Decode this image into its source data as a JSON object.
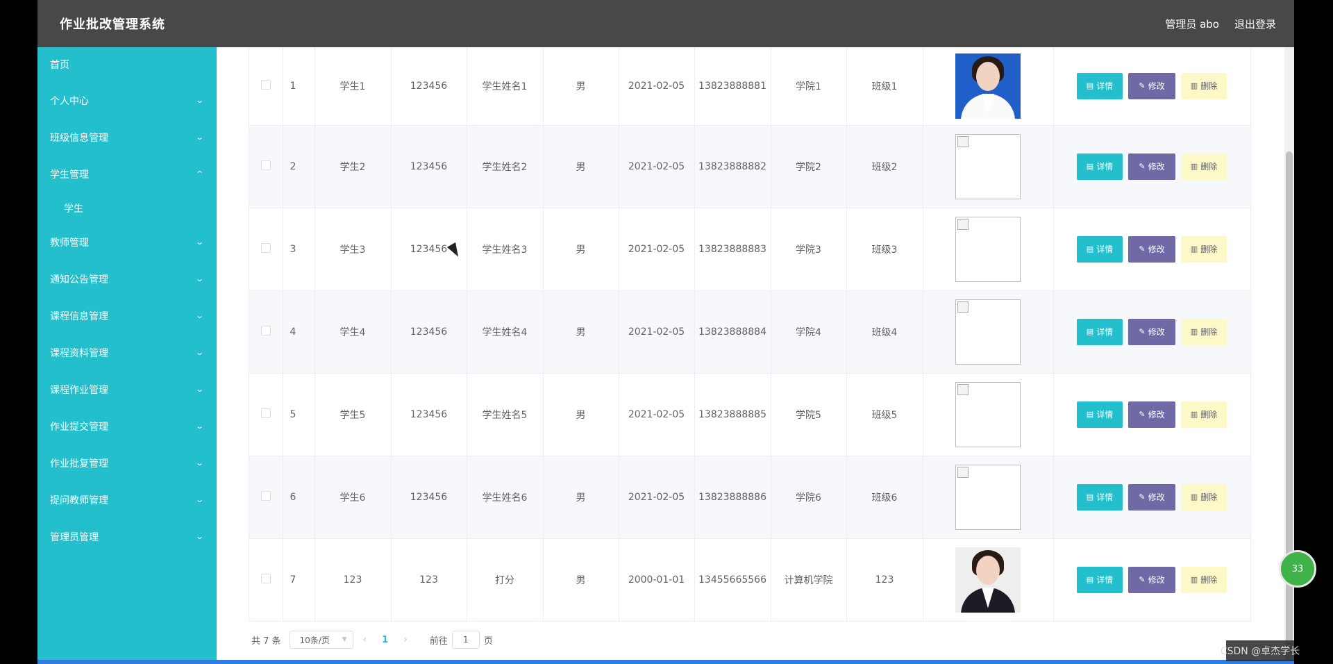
{
  "header": {
    "title": "作业批改管理系统",
    "user": "管理员 abo",
    "logout": "退出登录"
  },
  "sidebar": {
    "items": [
      {
        "label": "首页",
        "arrow": ""
      },
      {
        "label": "个人中心",
        "arrow": "⌄"
      },
      {
        "label": "班级信息管理",
        "arrow": "⌄"
      },
      {
        "label": "学生管理",
        "arrow": "⌃"
      },
      {
        "label": "学生",
        "arrow": ""
      },
      {
        "label": "教师管理",
        "arrow": "⌄"
      },
      {
        "label": "通知公告管理",
        "arrow": "⌄"
      },
      {
        "label": "课程信息管理",
        "arrow": "⌄"
      },
      {
        "label": "课程资料管理",
        "arrow": "⌄"
      },
      {
        "label": "课程作业管理",
        "arrow": "⌄"
      },
      {
        "label": "作业提交管理",
        "arrow": "⌄"
      },
      {
        "label": "作业批复管理",
        "arrow": "⌄"
      },
      {
        "label": "提问教师管理",
        "arrow": "⌄"
      },
      {
        "label": "管理员管理",
        "arrow": "⌄"
      }
    ]
  },
  "table": {
    "rows": [
      {
        "idx": "1",
        "account": "学生1",
        "password": "123456",
        "name": "学生姓名1",
        "gender": "男",
        "date": "2021-02-05",
        "phone": "13823888881",
        "college": "学院1",
        "clazz": "班级1"
      },
      {
        "idx": "2",
        "account": "学生2",
        "password": "123456",
        "name": "学生姓名2",
        "gender": "男",
        "date": "2021-02-05",
        "phone": "13823888882",
        "college": "学院2",
        "clazz": "班级2"
      },
      {
        "idx": "3",
        "account": "学生3",
        "password": "123456",
        "name": "学生姓名3",
        "gender": "男",
        "date": "2021-02-05",
        "phone": "13823888883",
        "college": "学院3",
        "clazz": "班级3"
      },
      {
        "idx": "4",
        "account": "学生4",
        "password": "123456",
        "name": "学生姓名4",
        "gender": "男",
        "date": "2021-02-05",
        "phone": "13823888884",
        "college": "学院4",
        "clazz": "班级4"
      },
      {
        "idx": "5",
        "account": "学生5",
        "password": "123456",
        "name": "学生姓名5",
        "gender": "男",
        "date": "2021-02-05",
        "phone": "13823888885",
        "college": "学院5",
        "clazz": "班级5"
      },
      {
        "idx": "6",
        "account": "学生6",
        "password": "123456",
        "name": "学生姓名6",
        "gender": "男",
        "date": "2021-02-05",
        "phone": "13823888886",
        "college": "学院6",
        "clazz": "班级6"
      },
      {
        "idx": "7",
        "account": "123",
        "password": "123",
        "name": "打分",
        "gender": "男",
        "date": "2000-01-01",
        "phone": "13455665566",
        "college": "计算机学院",
        "clazz": "123"
      }
    ],
    "actions": {
      "detail": "详情",
      "edit": "修改",
      "delete": "删除"
    }
  },
  "pagination": {
    "total": "共 7 条",
    "page_size": "10条/页",
    "prev": "‹",
    "current": "1",
    "next": "›",
    "goto_label": "前往",
    "goto_value": "1",
    "goto_suffix": "页"
  },
  "overlay": {
    "badge": "33",
    "watermark": "CSDN @卓杰学长"
  },
  "colors": {
    "accent": "#23bfcd",
    "edit": "#6f6aa6",
    "delete_bg": "#fdf8c8",
    "header": "#484848"
  }
}
